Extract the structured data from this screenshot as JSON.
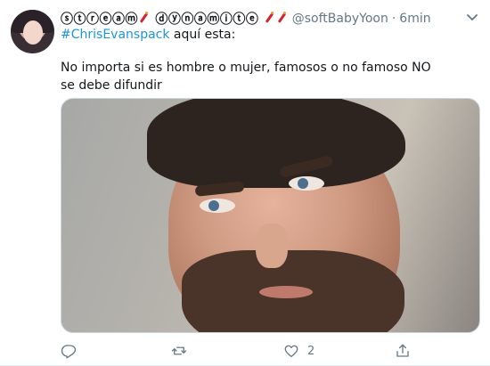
{
  "tweet": {
    "display_name": "ⓢⓣⓡⓔⓐⓜ",
    "display_name_tail": "ⓓⓨⓝⓐⓜⓘⓣⓔ",
    "handle": "@softBabyYoon",
    "separator": "·",
    "time": "6min",
    "hashtag": "#ChrisEvanspack",
    "line1_rest": " aquí esta:",
    "body": "No importa si es hombre o mujer, famosos o no famoso NO se debe difundir",
    "like_count": "2"
  },
  "colors": {
    "link": "#1b95e0",
    "secondary_text": "#657786",
    "primary_text": "#14171a"
  },
  "icons": {
    "reply": "reply-icon",
    "retweet": "retweet-icon",
    "like": "heart-icon",
    "share": "share-icon",
    "menu": "chevron-down-icon",
    "emoji": "firecracker-emoji-icon"
  }
}
